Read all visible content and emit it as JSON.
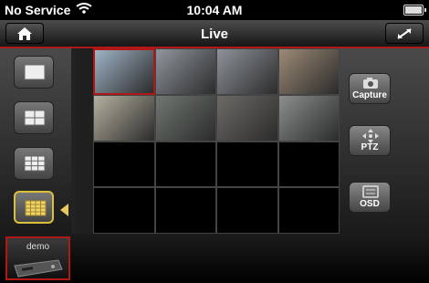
{
  "status": {
    "carrier": "No Service",
    "time": "10:04 AM",
    "wifi_icon": "wifi-icon",
    "battery_icon": "battery-icon"
  },
  "navbar": {
    "title": "Live",
    "left_icon": "home-icon",
    "right_icon": "expand-icon"
  },
  "layouts": [
    {
      "name": "1x1",
      "active": false
    },
    {
      "name": "2x2",
      "active": false
    },
    {
      "name": "3x3",
      "active": false
    },
    {
      "name": "4x4",
      "active": true
    }
  ],
  "video_grid": {
    "rows": 4,
    "cols": 4,
    "feeds": [
      {
        "scene": "news anchor",
        "color": "#9fb3c6"
      },
      {
        "scene": "street",
        "color": "#8f969d"
      },
      {
        "scene": "street",
        "color": "#8d939a"
      },
      {
        "scene": "street",
        "color": "#9d8a76"
      },
      {
        "scene": "street",
        "color": "#b5b1a0"
      },
      {
        "scene": "parking",
        "color": "#6f7771"
      },
      {
        "scene": "door",
        "color": "#6d6a66"
      },
      {
        "scene": "cars",
        "color": "#8a8f8e"
      }
    ]
  },
  "actions": {
    "capture": {
      "label": "Capture",
      "icon": "camera-icon"
    },
    "ptz": {
      "label": "PTZ",
      "icon": "ptz-arrows-icon"
    },
    "osd": {
      "label": "OSD",
      "icon": "osd-icon"
    }
  },
  "devices": [
    {
      "name": "demo",
      "icon": "dvr-device-icon"
    }
  ],
  "accent_color": "#b01818"
}
